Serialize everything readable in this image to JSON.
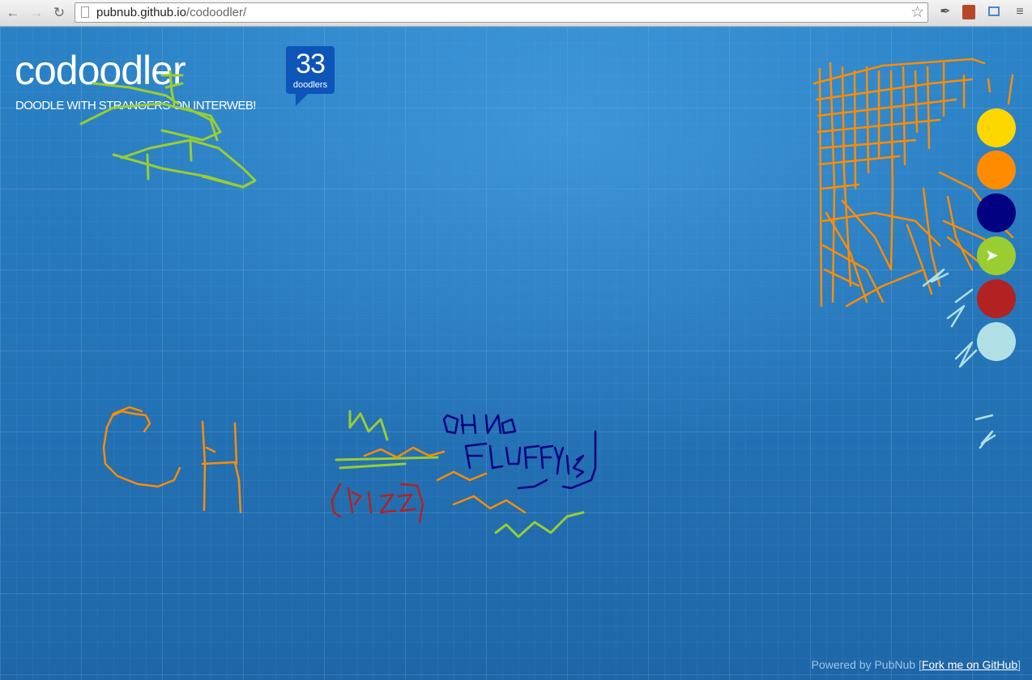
{
  "browser": {
    "url_host": "pubnub.github.io",
    "url_path": "/codoodler/",
    "back_icon": "arrow-left",
    "forward_icon": "arrow-right",
    "reload_icon": "reload",
    "star_icon": "star",
    "menu_icon": "hamburger"
  },
  "app": {
    "title": "codoodler",
    "tagline": "DOODLE WITH STRANGERS ON INTERWEB!",
    "counter": {
      "value": "33",
      "label": "doodlers"
    }
  },
  "palette": {
    "colors": [
      {
        "name": "yellow",
        "hex": "#FFD700"
      },
      {
        "name": "orange",
        "hex": "#FF8C00"
      },
      {
        "name": "navy",
        "hex": "#000080"
      },
      {
        "name": "green",
        "hex": "#9ACD32",
        "selected": true
      },
      {
        "name": "red",
        "hex": "#B22222"
      },
      {
        "name": "light-blue",
        "hex": "#B0E0E6"
      }
    ]
  },
  "footer": {
    "powered_by": "Powered by PubNub",
    "fork_link": "Fork me on GitHub"
  }
}
